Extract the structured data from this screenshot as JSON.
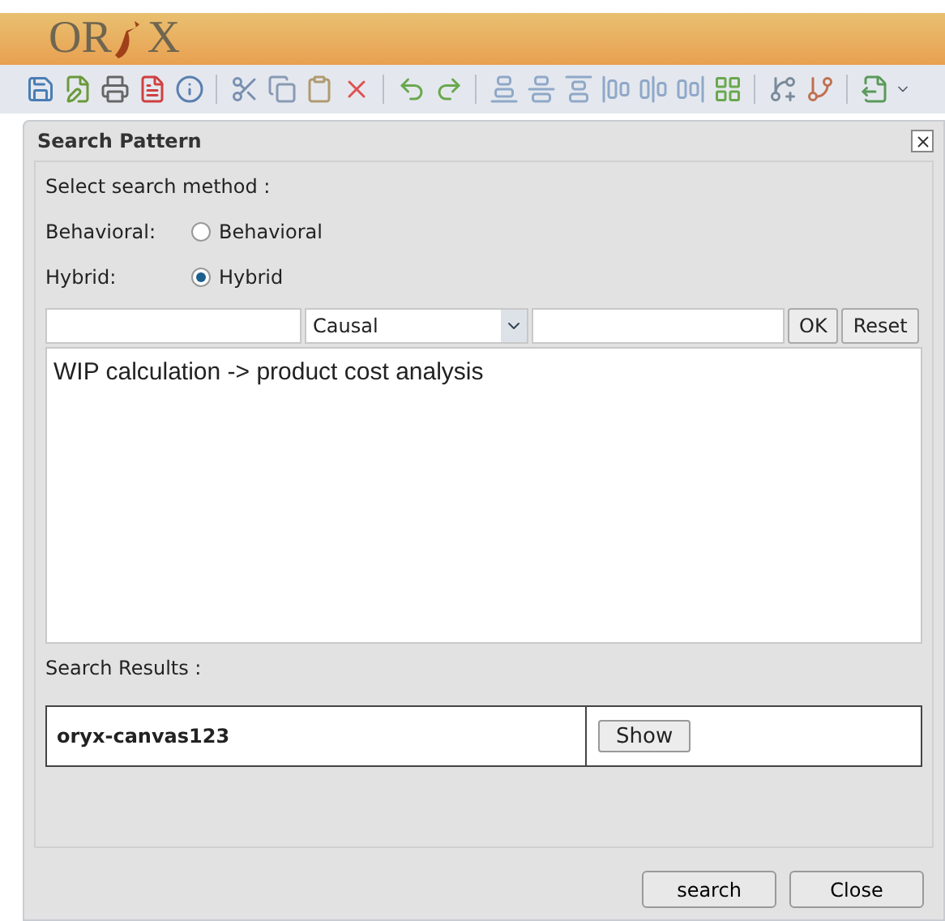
{
  "logo": {
    "left": "OR",
    "right": "X"
  },
  "toolbar": {
    "groups": [
      {
        "tools": [
          {
            "kind": "save"
          },
          {
            "kind": "edit"
          },
          {
            "kind": "print"
          },
          {
            "kind": "pdf"
          },
          {
            "kind": "info"
          }
        ]
      },
      {
        "tools": [
          {
            "kind": "cut"
          },
          {
            "kind": "copy"
          },
          {
            "kind": "paste"
          },
          {
            "kind": "delete"
          }
        ]
      },
      {
        "tools": [
          {
            "kind": "undo"
          },
          {
            "kind": "redo"
          }
        ]
      },
      {
        "tools": [
          {
            "kind": "align_bottom"
          },
          {
            "kind": "align_middle"
          },
          {
            "kind": "align_top"
          },
          {
            "kind": "align_left"
          },
          {
            "kind": "align_center"
          },
          {
            "kind": "align_right"
          },
          {
            "kind": "grid"
          }
        ]
      },
      {
        "tools": [
          {
            "kind": "add_node"
          },
          {
            "kind": "remove_node"
          }
        ]
      },
      {
        "tools": [
          {
            "kind": "export"
          }
        ]
      }
    ]
  },
  "dialog": {
    "title": "Search Pattern",
    "method_label": "Select search method :",
    "methods": [
      {
        "label": "Behavioral:",
        "option": "Behavioral",
        "selected": false
      },
      {
        "label": "Hybrid:",
        "option": "Hybrid",
        "selected": true
      }
    ],
    "query": {
      "relation": "Causal",
      "ok": "OK",
      "reset": "Reset"
    },
    "pattern_text": "WIP calculation -> product cost analysis",
    "results_label": "Search Results :",
    "results": [
      {
        "name": "oryx-canvas123",
        "action": "Show"
      }
    ],
    "buttons": [
      "search",
      "Close"
    ]
  }
}
